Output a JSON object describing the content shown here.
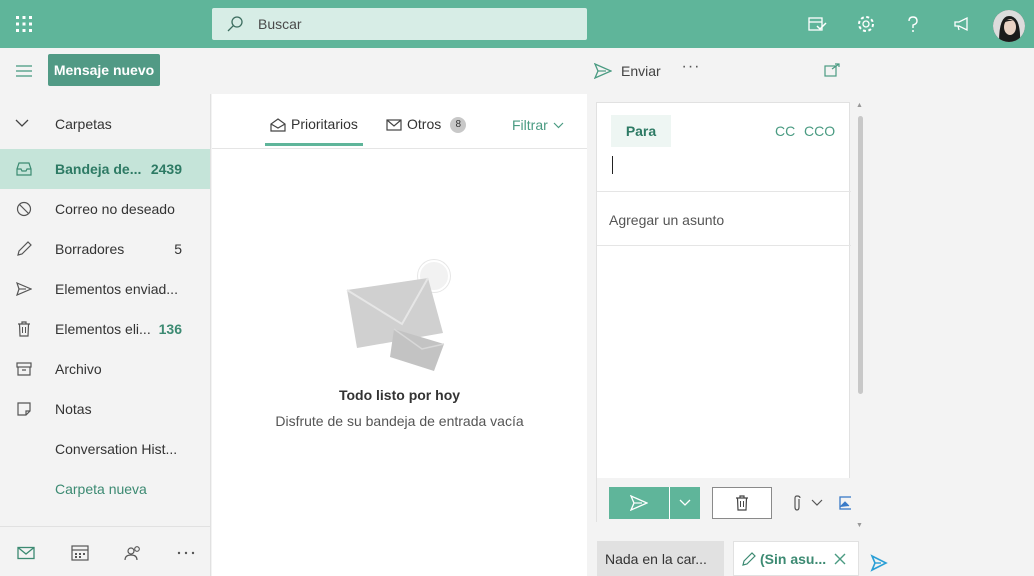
{
  "topbar": {
    "search_placeholder": "Buscar",
    "accent_color": "#5fb59a",
    "icons": [
      "app-launcher-icon",
      "my-day-icon",
      "settings-icon",
      "help-icon",
      "feedback-icon"
    ]
  },
  "command": {
    "new_message": "Mensaje nuevo",
    "send": "Enviar",
    "more": "···"
  },
  "sidebar": {
    "folders_label": "Carpetas",
    "items": [
      {
        "label": "Bandeja de...",
        "count": "2439",
        "icon": "inbox-icon"
      },
      {
        "label": "Correo no deseado",
        "count": "",
        "icon": "junk-icon"
      },
      {
        "label": "Borradores",
        "count": "5",
        "icon": "pencil-icon"
      },
      {
        "label": "Elementos enviad...",
        "count": "",
        "icon": "send-icon"
      },
      {
        "label": "Elementos eli...",
        "count": "136",
        "icon": "trash-icon"
      },
      {
        "label": "Archivo",
        "count": "",
        "icon": "archive-icon"
      },
      {
        "label": "Notas",
        "count": "",
        "icon": "note-icon"
      },
      {
        "label": "Conversation Hist...",
        "count": "",
        "icon": ""
      },
      {
        "label": "Carpeta nueva",
        "count": "",
        "icon": ""
      }
    ],
    "bottom_icons": [
      "mail-icon",
      "calendar-icon",
      "people-icon",
      "more-icon"
    ]
  },
  "list": {
    "tab_focused": "Prioritarios",
    "tab_other": "Otros",
    "other_count": "8",
    "filter": "Filtrar",
    "empty_title": "Todo listo por hoy",
    "empty_subtitle": "Disfrute de su bandeja de entrada vacía"
  },
  "compose": {
    "to_label": "Para",
    "cc": "CC",
    "bcc": "CCO",
    "to_value": "",
    "subject_placeholder": "Agregar un asunto"
  },
  "drafts": {
    "item1": "Nada en la car...",
    "item2": "(Sin asu..."
  }
}
